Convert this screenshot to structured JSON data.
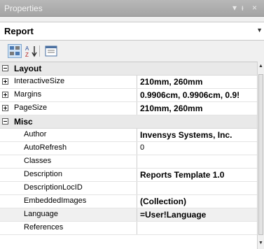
{
  "window": {
    "title": "Properties",
    "controls": {
      "dropdown": "▾",
      "pin": "ᵻ",
      "close": "×"
    }
  },
  "object_selector": {
    "value": "Report"
  },
  "toolbar": {
    "buttons": [
      {
        "icon": "categorized-icon"
      },
      {
        "icon": "alphabetical-icon",
        "glyph": "A↓"
      },
      {
        "icon": "property-pages-icon"
      }
    ]
  },
  "grid": {
    "layout_category": "Layout",
    "layout_rows": [
      {
        "name": "InteractiveSize",
        "value": "210mm, 260mm"
      },
      {
        "name": "Margins",
        "value": "0.9906cm, 0.9906cm, 0.9!"
      },
      {
        "name": "PageSize",
        "value": "210mm, 260mm"
      }
    ],
    "misc_category": "Misc",
    "misc_rows": [
      {
        "name": "Author",
        "value": "Invensys Systems, Inc."
      },
      {
        "name": "AutoRefresh",
        "value": "0"
      },
      {
        "name": "Classes",
        "value": ""
      },
      {
        "name": "Description",
        "value": "Reports Template 1.0"
      },
      {
        "name": "DescriptionLocID",
        "value": ""
      },
      {
        "name": "EmbeddedImages",
        "value": "(Collection)"
      },
      {
        "name": "Language",
        "value": "=User!Language"
      },
      {
        "name": "References",
        "value": ""
      }
    ]
  }
}
